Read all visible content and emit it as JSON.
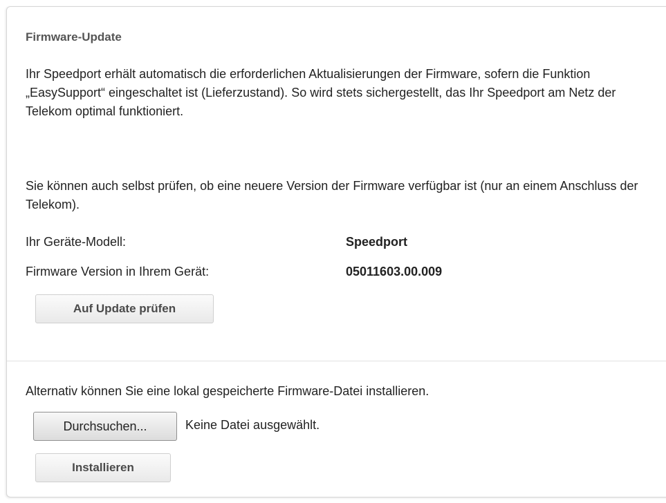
{
  "section": {
    "title": "Firmware-Update",
    "intro_paragraph": "Ihr Speedport erhält automatisch die erforderlichen Aktualisierungen der Firmware, sofern die Funktion „EasySupport“ eingeschaltet ist (Lieferzustand). So wird stets sichergestellt, das Ihr Speedport am Netz der Telekom optimal funktioniert.",
    "check_paragraph": "Sie können auch selbst prüfen, ob eine neuere Version der Firmware verfügbar ist (nur an einem Anschluss der Telekom).",
    "device_info": [
      {
        "label": "Ihr Geräte-Modell:",
        "value": "Speedport"
      },
      {
        "label": "Firmware Version in Ihrem Gerät:",
        "value": "05011603.00.009"
      }
    ],
    "check_button_label": "Auf Update prüfen"
  },
  "local_install": {
    "description": "Alternativ können Sie eine lokal gespeicherte Firmware-Datei installieren.",
    "browse_button_label": "Durchsuchen...",
    "file_status": "Keine Datei ausgewählt.",
    "install_button_label": "Installieren"
  }
}
